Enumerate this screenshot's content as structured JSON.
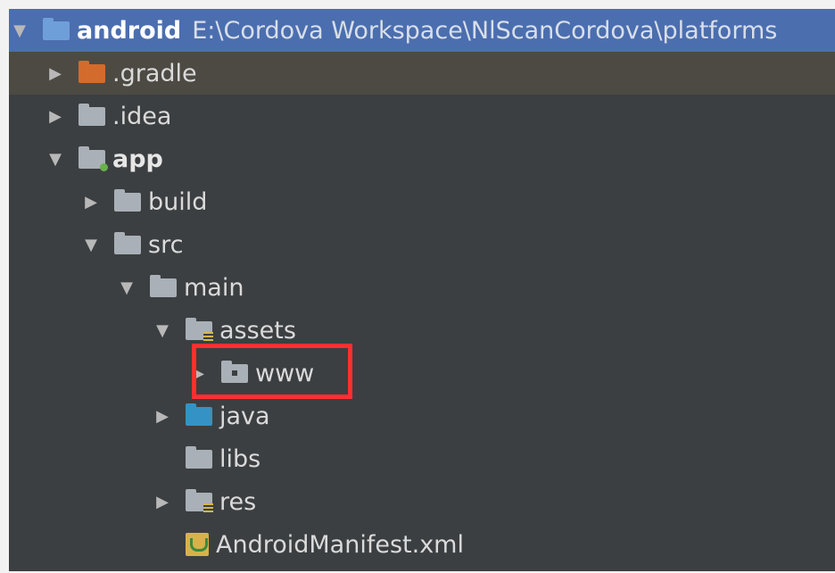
{
  "tree": [
    {
      "id": "android",
      "label": "android",
      "path": "E:\\Cordova Workspace\\NlScanCordova\\platforms",
      "expanded": true,
      "icon": "module-folder-icon"
    },
    {
      "id": "gradle",
      "label": ".gradle",
      "expanded": false,
      "icon": "folder-icon"
    },
    {
      "id": "idea",
      "label": ".idea",
      "expanded": false,
      "icon": "folder-icon"
    },
    {
      "id": "app",
      "label": "app",
      "expanded": true,
      "icon": "module-folder-icon"
    },
    {
      "id": "build",
      "label": "build",
      "expanded": false,
      "icon": "folder-icon"
    },
    {
      "id": "src",
      "label": "src",
      "expanded": true,
      "icon": "folder-icon"
    },
    {
      "id": "main",
      "label": "main",
      "expanded": true,
      "icon": "folder-icon"
    },
    {
      "id": "assets",
      "label": "assets",
      "expanded": true,
      "icon": "resources-folder-icon"
    },
    {
      "id": "www",
      "label": "www",
      "expanded": false,
      "icon": "package-folder-icon",
      "highlighted": true
    },
    {
      "id": "java",
      "label": "java",
      "expanded": false,
      "icon": "source-folder-icon"
    },
    {
      "id": "libs",
      "label": "libs",
      "icon": "folder-icon"
    },
    {
      "id": "res",
      "label": "res",
      "expanded": false,
      "icon": "resources-folder-icon"
    },
    {
      "id": "manifest",
      "label": "AndroidManifest.xml",
      "icon": "android-manifest-icon"
    }
  ],
  "colors": {
    "background": "#3c3f41",
    "selection": "#4b6eaf",
    "highlight": "#ff2f2f"
  }
}
